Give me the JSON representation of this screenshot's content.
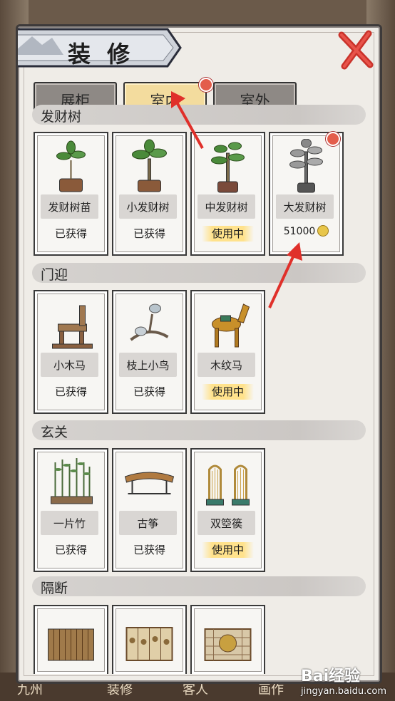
{
  "window": {
    "title": "装 修"
  },
  "tabs": [
    {
      "label": "展柜",
      "active": false
    },
    {
      "label": "室内",
      "active": true
    },
    {
      "label": "室外",
      "active": false
    }
  ],
  "sections": [
    {
      "title": "发财树",
      "items": [
        {
          "name": "发财树苗",
          "status": "已获得"
        },
        {
          "name": "小发财树",
          "status": "已获得"
        },
        {
          "name": "中发财树",
          "status": "使用中"
        },
        {
          "name": "大发财树",
          "price": "51000"
        }
      ]
    },
    {
      "title": "门迎",
      "items": [
        {
          "name": "小木马",
          "status": "已获得"
        },
        {
          "name": "枝上小鸟",
          "status": "已获得"
        },
        {
          "name": "木纹马",
          "status": "使用中"
        }
      ]
    },
    {
      "title": "玄关",
      "items": [
        {
          "name": "一片竹",
          "status": "已获得"
        },
        {
          "name": "古筝",
          "status": "已获得"
        },
        {
          "name": "双箜篌",
          "status": "使用中"
        }
      ]
    },
    {
      "title": "隔断",
      "items": [
        {
          "name": ""
        },
        {
          "name": ""
        },
        {
          "name": ""
        }
      ]
    }
  ],
  "bottom_tabs": [
    "九州",
    "装修",
    "客人",
    "画作"
  ],
  "watermark": {
    "brand": "Bai经验",
    "url": "jingyan.baidu.com"
  },
  "colors": {
    "accent": "#f3dc9e",
    "badge": "#e35d4b",
    "arrow": "#e0302a"
  }
}
